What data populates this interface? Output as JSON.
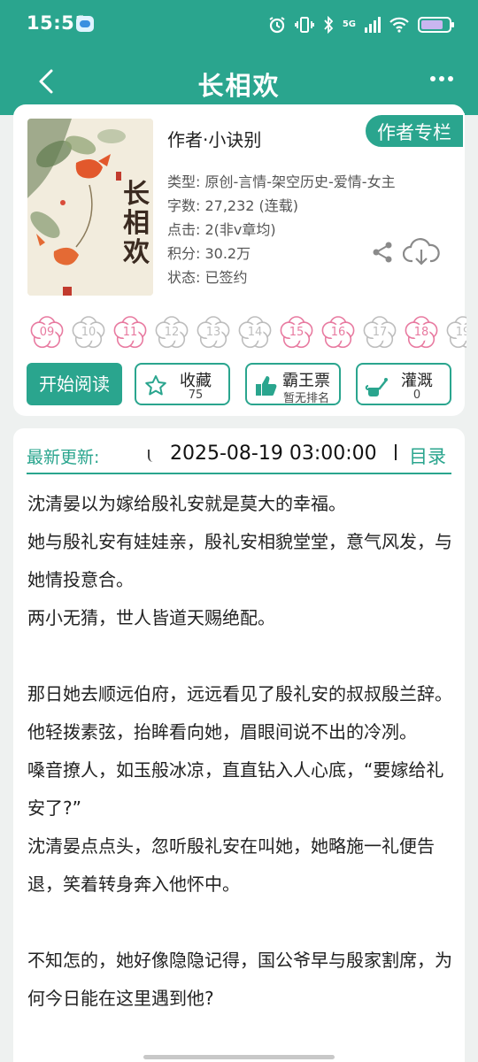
{
  "status_bar": {
    "time": "15:51",
    "network": "5G",
    "icons": [
      "message-app-icon",
      "alarm-icon",
      "vibrate-icon",
      "bluetooth-icon",
      "signal-icon",
      "wifi-icon",
      "battery-icon"
    ]
  },
  "header": {
    "title": "长相欢",
    "back_icon": "chevron-left-icon",
    "more_icon": "more-dots-icon"
  },
  "book": {
    "cover_title": "长相欢",
    "author_line": "作者·小诀别",
    "author_tag": "作者专栏",
    "meta": [
      "类型: 原创-言情-架空历史-爱情-女主",
      "字数: 27,232 (连载)",
      "点击: 2(非v章均)",
      "积分: 30.2万",
      "状态: 已签约"
    ],
    "share_icon": "share-icon",
    "download_icon": "cloud-download-icon"
  },
  "flowers": [
    {
      "num": "09",
      "active": true
    },
    {
      "num": "10",
      "active": false
    },
    {
      "num": "11",
      "active": true
    },
    {
      "num": "12",
      "active": false
    },
    {
      "num": "13",
      "active": false
    },
    {
      "num": "14",
      "active": false
    },
    {
      "num": "15",
      "active": true
    },
    {
      "num": "16",
      "active": true
    },
    {
      "num": "17",
      "active": false
    },
    {
      "num": "18",
      "active": true
    },
    {
      "num": "19",
      "active": false
    }
  ],
  "actions": {
    "start": "开始阅读",
    "favorite": {
      "label": "收藏",
      "count": "75"
    },
    "ticket": {
      "label": "霸王票",
      "sub": "暂无排名"
    },
    "water": {
      "label": "灌溉",
      "count": "0"
    }
  },
  "update": {
    "label": "最新更新:",
    "date": "2025-08-19 03:00:00",
    "toc": "目录"
  },
  "article": [
    "沈清晏以为嫁给殷礼安就是莫大的幸福。",
    "她与殷礼安有娃娃亲，殷礼安相貌堂堂，意气风发，与她情投意合。",
    "两小无猜，世人皆道天赐绝配。",
    "",
    "那日她去顺远伯府，远远看见了殷礼安的叔叔殷兰辞。他轻拨素弦，抬眸看向她，眉眼间说不出的冷冽。",
    "嗓音撩人，如玉般冰凉，直直钻入人心底，“要嫁给礼安了?”",
    "沈清晏点点头，忽听殷礼安在叫她，她略施一礼便告退，笑着转身奔入他怀中。",
    "",
    "不知怎的，她好像隐隐记得，国公爷早与殷家割席，为何今日能在这里遇到他?"
  ],
  "colors": {
    "accent": "#2aa58e",
    "flower_active": "#e87aa0",
    "flower_inactive": "#bdbdbd"
  }
}
